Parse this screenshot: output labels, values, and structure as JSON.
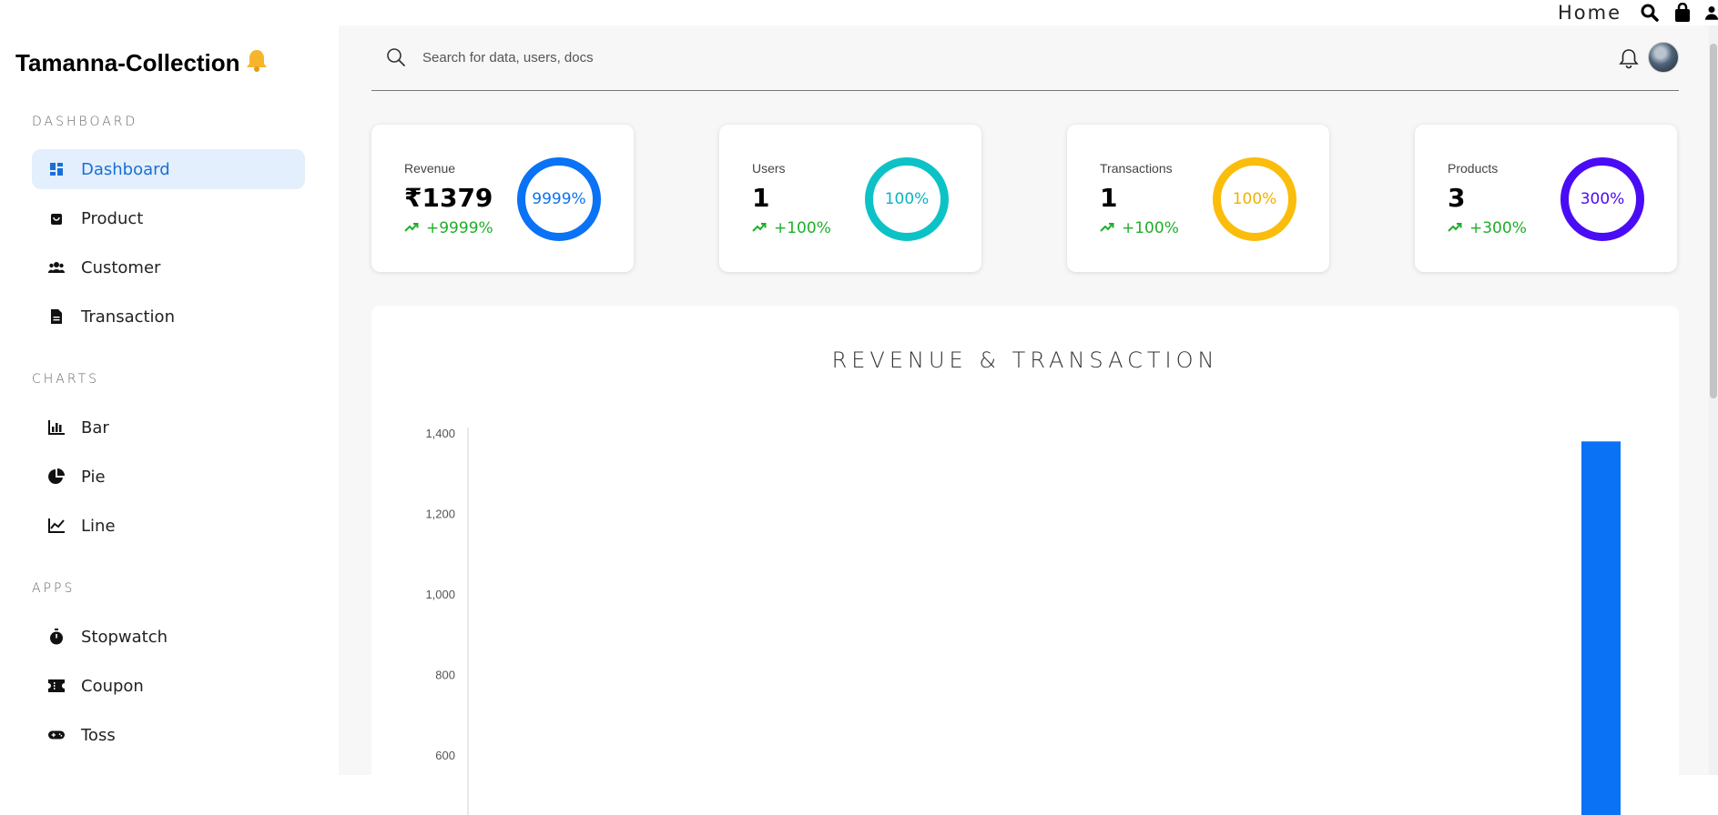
{
  "topnav": {
    "home_label": "Home"
  },
  "sidebar": {
    "brand": "Tamanna-Collection",
    "brand_icon": "bell-emoji",
    "sections": [
      {
        "title": "DASHBOARD",
        "items": [
          {
            "label": "Dashboard",
            "icon": "dashboard-icon",
            "active": true
          },
          {
            "label": "Product",
            "icon": "shopping-bag-icon"
          },
          {
            "label": "Customer",
            "icon": "people-icon"
          },
          {
            "label": "Transaction",
            "icon": "document-icon"
          }
        ]
      },
      {
        "title": "CHARTS",
        "items": [
          {
            "label": "Bar",
            "icon": "bar-chart-icon"
          },
          {
            "label": "Pie",
            "icon": "pie-chart-icon"
          },
          {
            "label": "Line",
            "icon": "line-chart-icon"
          }
        ]
      },
      {
        "title": "APPS",
        "items": [
          {
            "label": "Stopwatch",
            "icon": "stopwatch-icon"
          },
          {
            "label": "Coupon",
            "icon": "coupon-icon"
          },
          {
            "label": "Toss",
            "icon": "gamepad-icon"
          }
        ]
      }
    ]
  },
  "search": {
    "placeholder": "Search for data, users, docs"
  },
  "cards": [
    {
      "label": "Revenue",
      "value": "₹1379",
      "change": "+9999%",
      "ring_text": "9999%",
      "color": "#0a72f5"
    },
    {
      "label": "Users",
      "value": "1",
      "change": "+100%",
      "ring_text": "100%",
      "color": "#0cc2c7"
    },
    {
      "label": "Transactions",
      "value": "1",
      "change": "+100%",
      "ring_text": "100%",
      "color": "#fbbd0b"
    },
    {
      "label": "Products",
      "value": "3",
      "change": "+300%",
      "ring_text": "300%",
      "color": "#4a0cf5"
    }
  ],
  "chart_data": {
    "type": "bar",
    "title": "REVENUE & TRANSACTION",
    "y_ticks": [
      "1,400",
      "1,200",
      "1,000",
      "800",
      "600"
    ],
    "ylim": [
      600,
      1400
    ],
    "series": [
      {
        "values": [
          0,
          0,
          0,
          0,
          0,
          1379
        ]
      }
    ],
    "bar_color": "#0a72f5"
  }
}
